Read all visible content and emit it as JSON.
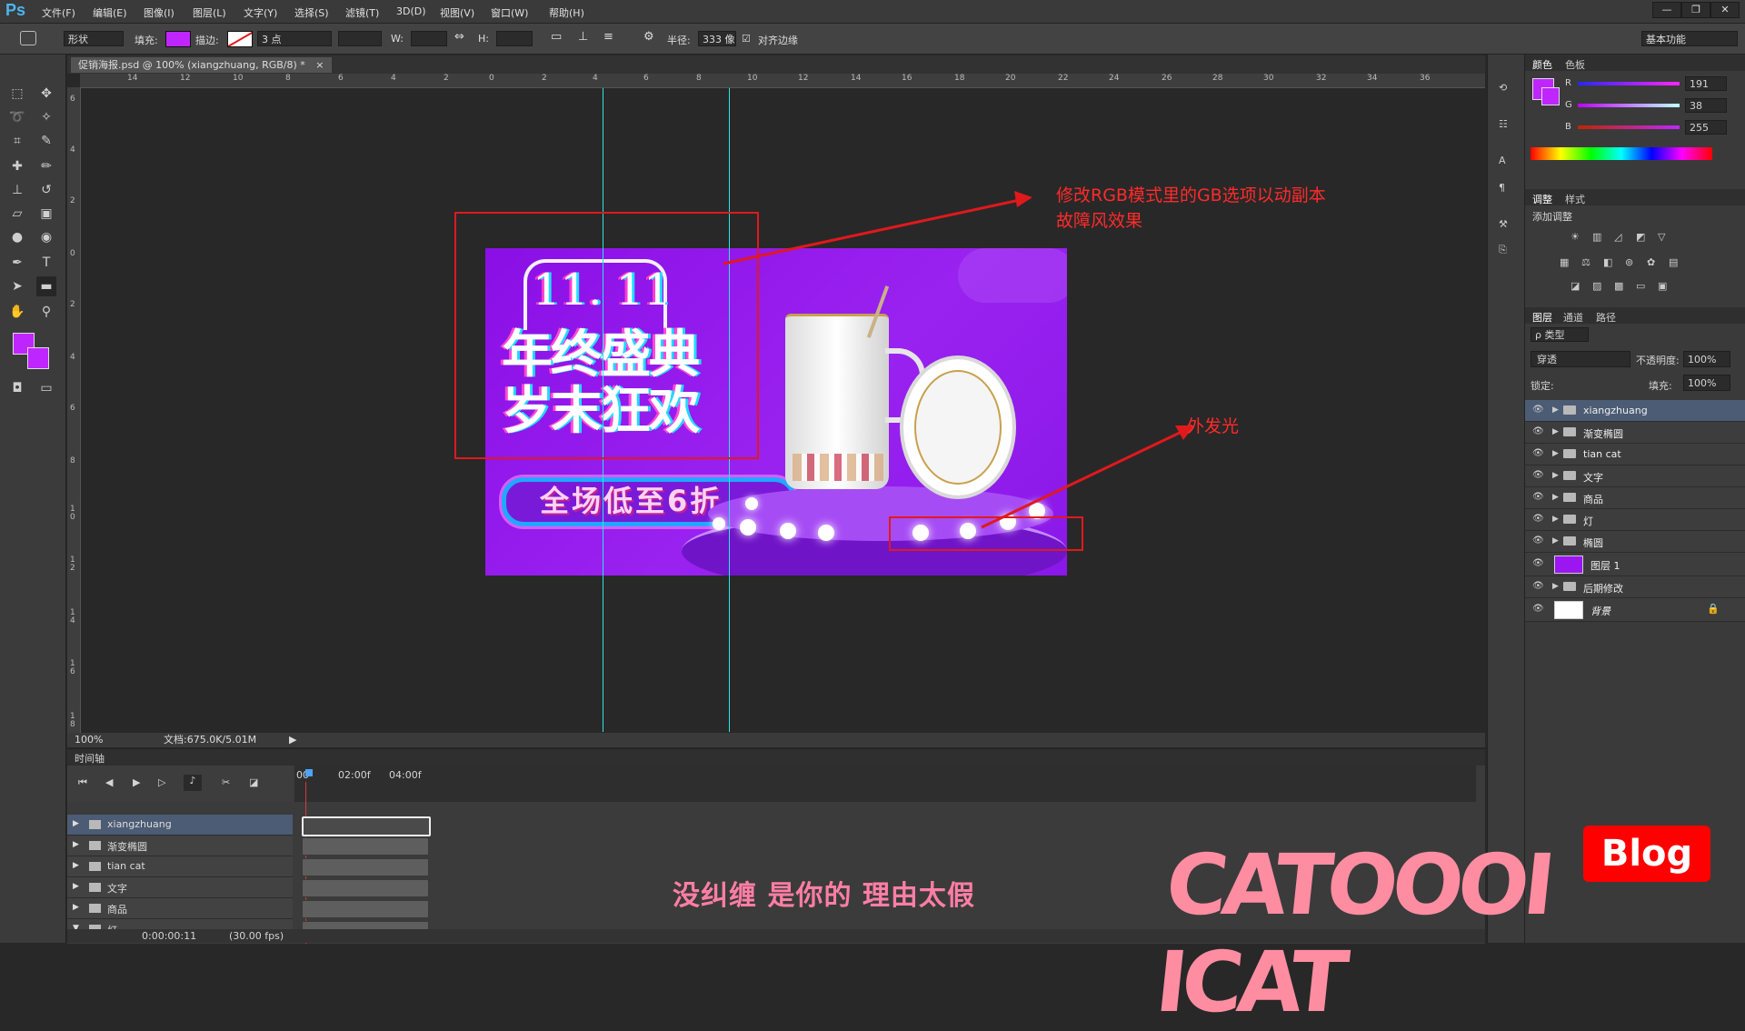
{
  "app": {
    "logo": "Ps"
  },
  "menu": [
    "文件(F)",
    "编辑(E)",
    "图像(I)",
    "图层(L)",
    "文字(Y)",
    "选择(S)",
    "滤镜(T)",
    "3D(D)",
    "视图(V)",
    "窗口(W)",
    "帮助(H)"
  ],
  "window_controls": {
    "min": "—",
    "restore": "❐",
    "close": "✕"
  },
  "options": {
    "shape_mode": "形状",
    "fill_label": "填充:",
    "stroke_label": "描边:",
    "stroke_size": "3 点",
    "w_label": "W:",
    "h_label": "H:",
    "radius_label": "半径:",
    "radius_value": "333 像",
    "align_edges": "对齐边缘",
    "workspace": "基本功能"
  },
  "colors": {
    "foreground": "#bf26ff",
    "accent": "#e0191d"
  },
  "document": {
    "tab_title": "促销海报.psd @ 100% (xiangzhuang, RGB/8) *",
    "close": "×"
  },
  "ruler": {
    "h_ticks": [
      "14",
      "12",
      "10",
      "8",
      "6",
      "4",
      "2",
      "0",
      "2",
      "4",
      "6",
      "8",
      "10",
      "12",
      "14",
      "16",
      "18",
      "20",
      "22",
      "24",
      "26",
      "28",
      "30",
      "32",
      "34",
      "36"
    ],
    "v_ticks": [
      "6",
      "4",
      "2",
      "0",
      "2",
      "4",
      "6",
      "8",
      "1\n0",
      "1\n2",
      "1\n4",
      "1\n6",
      "1\n8"
    ]
  },
  "poster": {
    "cat_text": "11. 11",
    "title_line1": "年终盛典",
    "title_line2": "岁末狂欢",
    "promo": "全场低至6折"
  },
  "annotations": {
    "note1_line1": "修改RGB模式里的GB选项以动副本",
    "note1_line2": "故障风效果",
    "note2": "外发光"
  },
  "status": {
    "zoom": "100%",
    "doc": "文档:675.0K/5.01M"
  },
  "timeline": {
    "title": "时间轴",
    "time_marks": [
      "00",
      "02:00f",
      "04:00f"
    ],
    "layers": [
      "xiangzhuang",
      "渐变椭圆",
      "tian cat",
      "文字",
      "商品",
      "灯"
    ],
    "current_time": "0:00:00:11",
    "fps": "(30.00 fps)"
  },
  "color_panel": {
    "tabs": [
      "颜色",
      "色板"
    ],
    "r_label": "R",
    "g_label": "G",
    "b_label": "B",
    "r": "191",
    "g": "38",
    "b": "255"
  },
  "adjust_panel": {
    "tabs": [
      "调整",
      "样式"
    ],
    "title": "添加调整"
  },
  "layers_panel": {
    "tabs": [
      "图层",
      "通道",
      "路径"
    ],
    "kind": "ρ 类型",
    "blend": "穿透",
    "opacity_label": "不透明度:",
    "opacity": "100%",
    "lock_label": "锁定:",
    "fill_label": "填充:",
    "fill": "100%",
    "layers": [
      "xiangzhuang",
      "渐变椭圆",
      "tian cat",
      "文字",
      "商品",
      "灯",
      "椭圆",
      "图层 1",
      "后期修改",
      "背景"
    ]
  },
  "overlay": {
    "subtitle": "没纠缠 是你的 理由太假",
    "watermark": "CATOOOI ICAT",
    "blog": "Blog"
  }
}
